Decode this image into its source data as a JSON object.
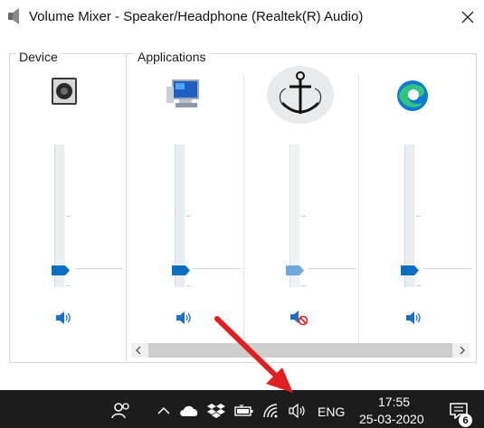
{
  "window": {
    "title": "Volume Mixer - Speaker/Headphone (Realtek(R) Audio)",
    "title_icon": "speaker-icon",
    "close_icon": "close-icon"
  },
  "sections": {
    "device_label": "Device",
    "applications_label": "Applications"
  },
  "channels": [
    {
      "id": "device-speaker",
      "icon": "speaker-device-icon",
      "volume_fraction": 0.18,
      "muted": false,
      "mute_icon": "speaker-icon"
    },
    {
      "id": "app-system-sounds",
      "icon": "system-sounds-icon",
      "volume_fraction": 0.18,
      "muted": false,
      "mute_icon": "speaker-icon"
    },
    {
      "id": "app-anchor",
      "icon": "anchor-icon",
      "volume_fraction": 0.18,
      "muted": true,
      "mute_icon": "speaker-muted-icon"
    },
    {
      "id": "app-edge",
      "icon": "edge-icon",
      "volume_fraction": 0.18,
      "muted": false,
      "mute_icon": "speaker-icon"
    }
  ],
  "taskbar": {
    "language": "ENG",
    "time": "17:55",
    "date": "25-03-2020",
    "notification_count": "6"
  },
  "colors": {
    "accent": "#0a6fc2",
    "taskbar": "#1c1c1c",
    "annotation_arrow": "#e02020"
  }
}
